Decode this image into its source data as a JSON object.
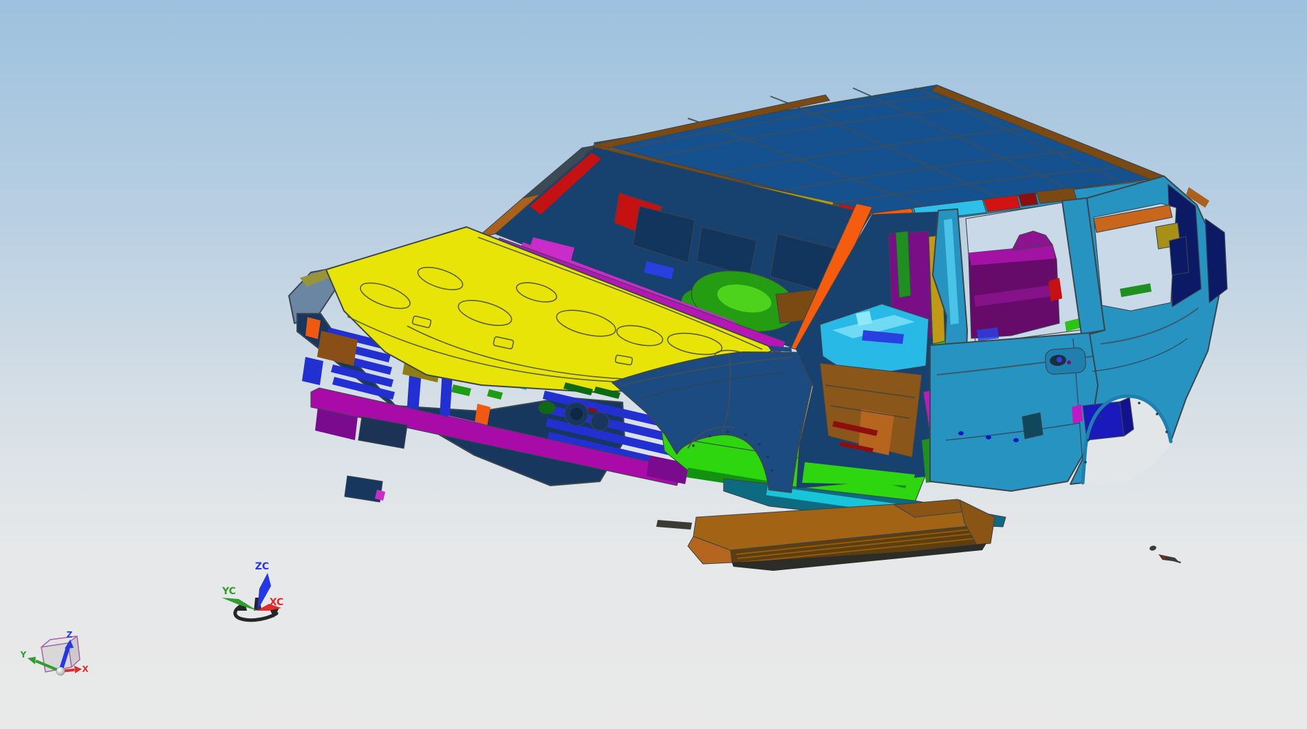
{
  "scene": {
    "background": {
      "top": "#9dc1de",
      "upper_mid": "#b9cfe2",
      "mid": "#d6dfe6",
      "low": "#e6e8e9",
      "bottom": "#e9e9e9"
    }
  },
  "wcs_triad": {
    "z_label": "ZC",
    "y_label": "YC",
    "x_label": "XC",
    "z_color": "#2536e8",
    "y_color": "#2f9e2f",
    "x_color": "#df2b2b",
    "orbit_color": "#262626"
  },
  "view_triad": {
    "z_label": "Z",
    "y_label": "Y",
    "x_label": "X",
    "z_color": "#2536e8",
    "y_color": "#2f9e2f",
    "x_color": "#d83030",
    "cube_edge": "#a265a5",
    "cube_face_top": "#e2e2e2",
    "cube_face_front": "#d6d6d6",
    "cube_face_right": "#c8c8c8",
    "sphere_color": "#cfcfcf"
  },
  "model": {
    "palette": {
      "roof_blue": "#15518f",
      "rail_teal": "#2596c4",
      "seg_orange": "#f55c0e",
      "seg_cyan": "#2cc0ea",
      "seg_red": "#d31212",
      "seg_red_dark": "#8e0e0e",
      "seg_brown": "#7a4a12",
      "header_navy": "#173f73",
      "olive_strip": "#a89b15",
      "red_part": "#c41111",
      "pillar_copper": "#a9611e",
      "pillar_dark": "#3c4a55",
      "interior_navy": "#17416f",
      "interior_navy2": "#12355e",
      "magenta_cowl": "#b516b5",
      "magenta_bright": "#c92cc9",
      "green_hump": "#259d12",
      "green_hump_hi": "#4ed31d",
      "hood_yellow": "#e9e408",
      "fender_plate": "#6b86a3",
      "plate_olive": "#97943a",
      "clip_navy": "#17375f",
      "clip_box": "#1c3355",
      "blue_frame": "#2230d2",
      "magenta_bar": "#a90ba9",
      "purple_patch": "#7a0a8e",
      "orange_bit": "#f05a10",
      "green_bit": "#1e9c14",
      "green_dark": "#0b6a12",
      "olive_bit": "#8f7d12",
      "aqua_bit": "#17b8c8",
      "copper_patch": "#8a4f16",
      "fender_blue": "#1b4b80",
      "floor_green": "#2ed60f",
      "floor_green_dark": "#129210",
      "floor_brown": "#8a5619",
      "floor_orange": "#b5651d",
      "red_mark": "#8e0e0e",
      "dash_cyan": "#29b9e6",
      "dash_cyan_hi": "#8ce8fa",
      "blue_strip": "#2a3fe0",
      "panel_purple": "#7a0e86",
      "gold_strip": "#c09a16",
      "green_strip": "#1f8f1f",
      "body_teal": "#2693c1",
      "body_teal_dark": "#1f7fae",
      "pillar_hi_cyan": "#49c4e8",
      "trim_green": "#2bc414",
      "trim_magenta": "#c217c2",
      "cargo_purple": "#670b6b",
      "cargo_purple_top": "#a313a3",
      "cargo_purple_hi": "#8d1490",
      "window_sky": "#c9d9e8",
      "arch_bg": "#e3e6e8",
      "box_blue": "#1a1abc",
      "box_blue_side": "#12128e",
      "navy_window": "#0c1a66",
      "quarter_orange": "#c8661c",
      "olive_plate": "#a89018",
      "sill_cyan": "#17c4d8",
      "rocker_teal": "#0e6a80",
      "pocket_dark": "#11475a",
      "board_top": "#a26315",
      "board_face": "#5e3e0e",
      "board_tread": "#8f5c12",
      "board_cap": "#b5651d",
      "board_brown2": "#8a5414",
      "board_dark": "#2c2c28",
      "shadow_dark": "#3a3a36",
      "rivet_blue": "#1515c8",
      "fragment_red": "#a02020"
    }
  }
}
